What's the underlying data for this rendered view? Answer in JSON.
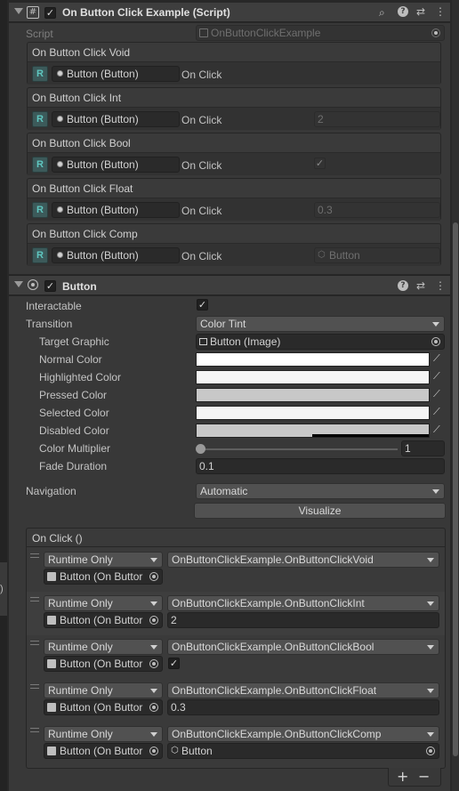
{
  "script_component": {
    "title": "On Button Click Example (Script)",
    "script_label": "Script",
    "script_value": "OnButtonClickExample",
    "events": [
      {
        "title": "On Button Click Void",
        "object": "Button (Button)",
        "trigger": "On Click",
        "param": ""
      },
      {
        "title": "On Button Click Int",
        "object": "Button (Button)",
        "trigger": "On Click",
        "param": "2"
      },
      {
        "title": "On Button Click Bool",
        "object": "Button (Button)",
        "trigger": "On Click",
        "param": "✓"
      },
      {
        "title": "On Button Click Float",
        "object": "Button (Button)",
        "trigger": "On Click",
        "param": "0.3"
      },
      {
        "title": "On Button Click Comp",
        "object": "Button (Button)",
        "trigger": "On Click",
        "param": "Button"
      }
    ],
    "r_label": "R"
  },
  "button_component": {
    "title": "Button",
    "interactable_label": "Interactable",
    "transition_label": "Transition",
    "transition_value": "Color Tint",
    "target_graphic_label": "Target Graphic",
    "target_graphic_value": "Button (Image)",
    "colors": [
      {
        "label": "Normal Color",
        "hex": "#ffffff"
      },
      {
        "label": "Highlighted Color",
        "hex": "#f5f5f5"
      },
      {
        "label": "Pressed Color",
        "hex": "#c8c8c8"
      },
      {
        "label": "Selected Color",
        "hex": "#f5f5f5"
      },
      {
        "label": "Disabled Color",
        "hex": "#c8c8c8"
      }
    ],
    "color_multiplier_label": "Color Multiplier",
    "color_multiplier_value": "1",
    "fade_duration_label": "Fade Duration",
    "fade_duration_value": "0.1",
    "navigation_label": "Navigation",
    "navigation_value": "Automatic",
    "visualize_label": "Visualize",
    "onclick_title": "On Click ()",
    "listeners": [
      {
        "mode": "Runtime Only",
        "method": "OnButtonClickExample.OnButtonClickVoid",
        "target": "Button (On Buttor",
        "arg": ""
      },
      {
        "mode": "Runtime Only",
        "method": "OnButtonClickExample.OnButtonClickInt",
        "target": "Button (On Buttor",
        "arg": "2"
      },
      {
        "mode": "Runtime Only",
        "method": "OnButtonClickExample.OnButtonClickBool",
        "target": "Button (On Buttor",
        "arg": "✓"
      },
      {
        "mode": "Runtime Only",
        "method": "OnButtonClickExample.OnButtonClickFloat",
        "target": "Button (On Buttor",
        "arg": "0.3"
      },
      {
        "mode": "Runtime Only",
        "method": "OnButtonClickExample.OnButtonClickComp",
        "target": "Button (On Buttor",
        "arg": "Button"
      }
    ],
    "add_label": "+",
    "remove_label": "−"
  },
  "left_edge_glyph": ")",
  "header_icons": [
    "search-icon",
    "help-icon",
    "presets-icon",
    "more-icon"
  ]
}
